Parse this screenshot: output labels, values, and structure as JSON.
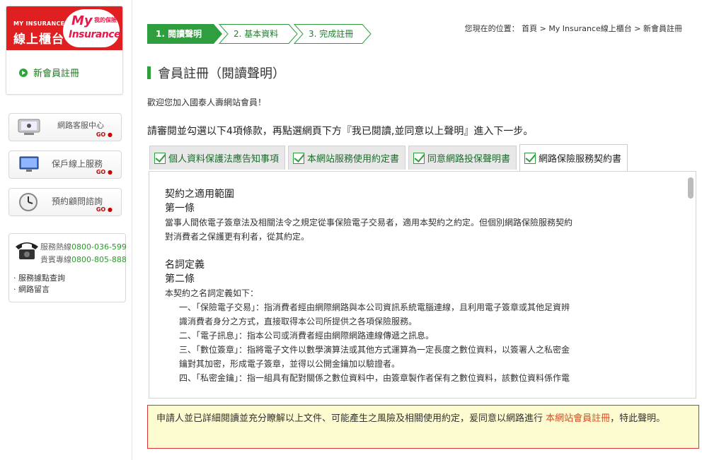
{
  "sidebar": {
    "brand": {
      "top": "MY INSURANCE",
      "main": "線上櫃台",
      "my": "My",
      "sub": "我的保險",
      "ins": "Insurance"
    },
    "menu": [
      {
        "label": "新會員註冊"
      }
    ],
    "services": [
      {
        "label": "網路客服中心",
        "go": "GO",
        "icon": "computer-support-icon"
      },
      {
        "label": "保戶線上服務",
        "go": "GO",
        "icon": "monitor-icon"
      },
      {
        "label": "預約顧問諮詢",
        "go": "GO",
        "icon": "clock-icon"
      }
    ],
    "hotline": {
      "service_label": "服務熱線",
      "service_number": "0800-036-599",
      "vip_label": "貴賓專線",
      "vip_number": "0800-805-888",
      "links": [
        "· 服務據點查詢",
        "· 網路留言"
      ]
    }
  },
  "steps": [
    {
      "label": "1. 閱讀聲明",
      "active": true
    },
    {
      "label": "2. 基本資料",
      "active": false
    },
    {
      "label": "3. 完成註冊",
      "active": false
    }
  ],
  "breadcrumb": "您現在的位置： 首頁 > My Insurance線上櫃台 > 新會員註冊",
  "page_title": "會員註冊（閱讀聲明）",
  "welcome": "歡迎您加入國泰人壽網站會員！",
  "instruction": "請審閱並勾選以下4項條款，再點選網頁下方『我已閱讀,並同意以上聲明』進入下一步。",
  "tabs": [
    {
      "label": "個人資料保護法應告知事項",
      "active": false
    },
    {
      "label": "本網站服務使用約定書",
      "active": false
    },
    {
      "label": "同意網路投保聲明書",
      "active": false
    },
    {
      "label": "網路保險服務契約書",
      "active": true
    }
  ],
  "content": {
    "sec1_title": "契約之適用範圍",
    "sec1_article": "第一條",
    "sec1_body1": "當事人間依電子簽章法及相關法令之規定從事保險電子交易者，適用本契約之約定。但個別網路保險服務契約",
    "sec1_body2": "對消費者之保護更有利者，從其約定。",
    "sec2_title": "名詞定義",
    "sec2_article": "第二條",
    "sec2_intro": "本契約之名詞定義如下：",
    "items": [
      "一、「保險電子交易」：指消費者經由網際網路與本公司資訊系統電腦連線，且利用電子簽章或其他足資辨",
      "識消費者身分之方式，直接取得本公司所提供之各項保險服務。",
      "二、「電子訊息」：指本公司或消費者經由網際網路連線傳遞之訊息。",
      "三、「數位簽章」：指將電子文件以數學演算法或其他方式運算為一定長度之數位資料，以簽署人之私密金",
      "鑰對其加密，形成電子簽章，並得以公開金鑰加以驗證者。",
      "四、「私密金鑰」：指一組具有配對關係之數位資料中，由簽章製作者保有之數位資料，該數位資料係作電"
    ]
  },
  "declaration": {
    "text_before": "申請人並已詳細閱讀並充分瞭解以上文件、可能產生之風險及相關使用約定，爰同意以網路進行 ",
    "highlight": "本網站會員註冊",
    "text_after": "，特此聲明。"
  },
  "colors": {
    "brand_red": "#e02020",
    "accent_green": "#2e9e3e",
    "highlight_orange": "#e5461b",
    "declare_bg": "#fdfbd0"
  }
}
